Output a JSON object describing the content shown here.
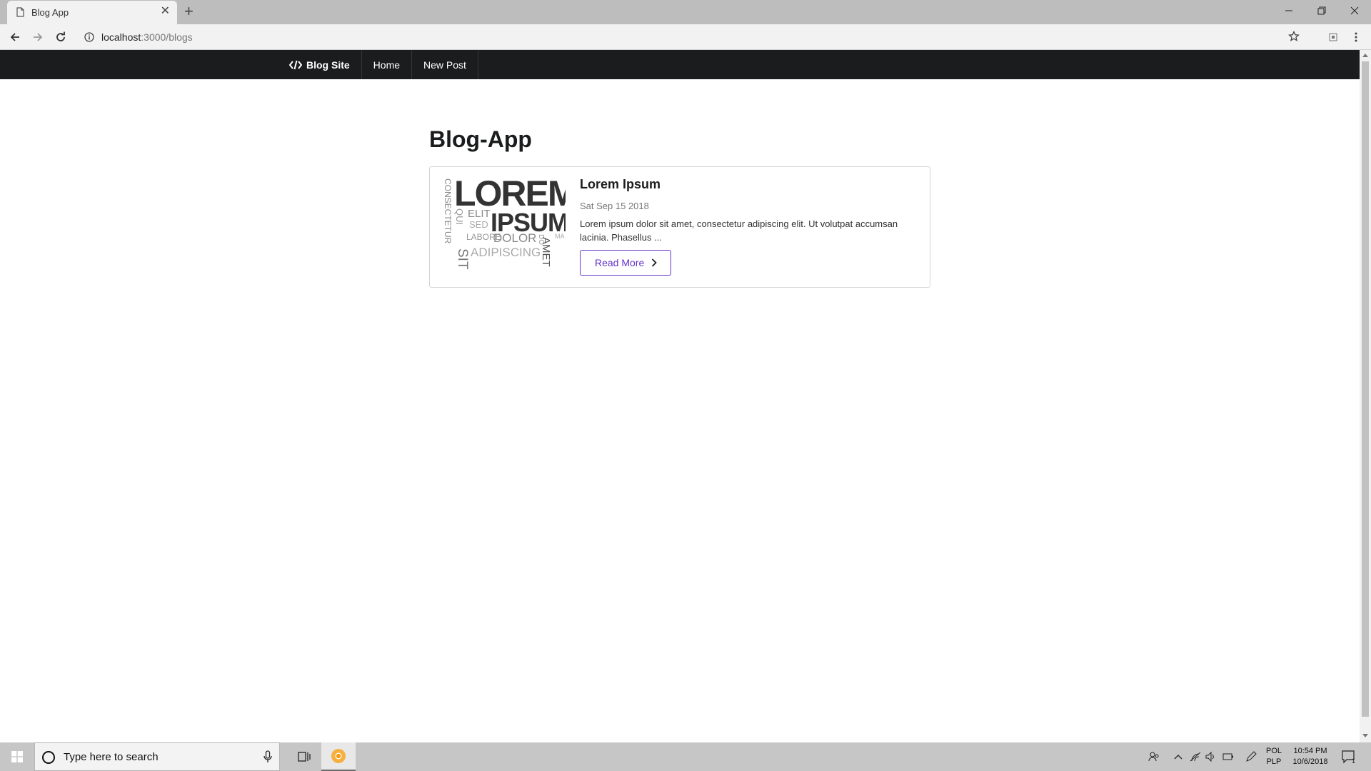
{
  "browser": {
    "tab_title": "Blog App",
    "url_host": "localhost",
    "url_path": ":3000/blogs"
  },
  "menu": {
    "brand": "Blog Site",
    "items": [
      "Home",
      "New Post"
    ]
  },
  "page": {
    "title": "Blog-App"
  },
  "posts": [
    {
      "title": "Lorem Ipsum",
      "date": "Sat Sep 15 2018",
      "excerpt": "Lorem ipsum dolor sit amet, consectetur adipiscing elit. Ut volutpat accumsan lacinia. Phasellus ...",
      "button": "Read More"
    }
  ],
  "image_words": {
    "lorem": "LOREM",
    "ipsum": "IPSUM",
    "consectetur": "CONSECTETUR",
    "qui": "QUI",
    "elit": "ELIT",
    "sed": "SED",
    "labore": "LABORE",
    "dolor": "DOLOR",
    "amet": "AMET",
    "sit": "SIT",
    "adipiscing": "ADIPISCING",
    "do": "DO",
    "ma": "MA"
  },
  "taskbar": {
    "search_placeholder": "Type here to search",
    "lang_1": "POL",
    "lang_2": "PLP",
    "time": "10:54 PM",
    "date": "10/6/2018",
    "notifications": "1"
  },
  "colors": {
    "menu_bg": "#1b1c1d",
    "accent": "#6435c9"
  }
}
